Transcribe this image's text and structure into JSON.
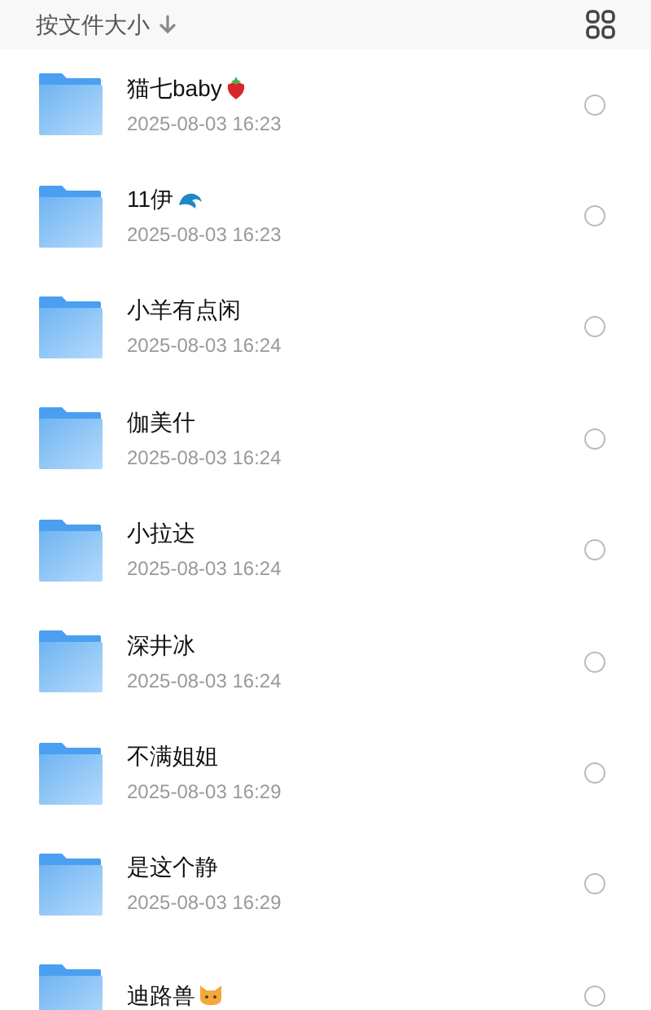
{
  "header": {
    "sort_label": "按文件大小"
  },
  "files": [
    {
      "name": "猫七baby",
      "kind": "strawberry",
      "date": "2025-08-03 16:23",
      "selected": false
    },
    {
      "name": "11伊",
      "kind": "wave",
      "date": "2025-08-03 16:23",
      "selected": false
    },
    {
      "name": "小羊有点闲",
      "kind": "plain",
      "date": "2025-08-03 16:24",
      "selected": false
    },
    {
      "name": "伽美什",
      "kind": "plain",
      "date": "2025-08-03 16:24",
      "selected": false
    },
    {
      "name": "小拉达",
      "kind": "plain",
      "date": "2025-08-03 16:24",
      "selected": false
    },
    {
      "name": "深井冰",
      "kind": "plain",
      "date": "2025-08-03 16:24",
      "selected": false
    },
    {
      "name": "不满姐姐",
      "kind": "plain",
      "date": "2025-08-03 16:29",
      "selected": false
    },
    {
      "name": "是这个静",
      "kind": "plain",
      "date": "2025-08-03 16:29",
      "selected": false
    },
    {
      "name": "迪路兽",
      "kind": "cat",
      "selected": false
    }
  ]
}
